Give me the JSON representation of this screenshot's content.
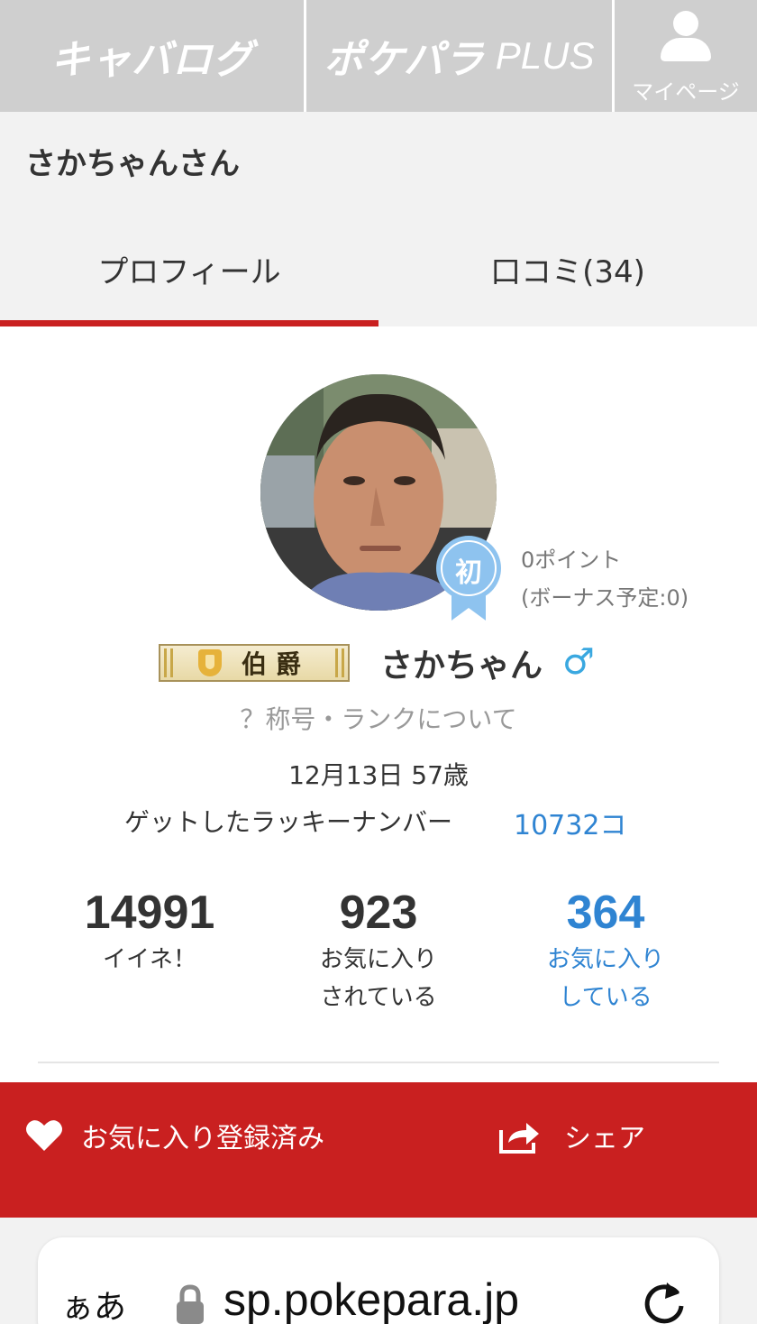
{
  "topnav": {
    "logo1": "キャバログ",
    "logo2": "ポケパラ",
    "logo2_suffix": "PLUS",
    "mypage_label": "マイページ"
  },
  "header": {
    "title": "さかちゃんさん"
  },
  "tabs": [
    {
      "label": "プロフィール",
      "active": true
    },
    {
      "label": "口コミ(34)",
      "active": false
    }
  ],
  "profile": {
    "badge_label": "初",
    "points": "0ポイント",
    "bonus": "(ボーナス予定:0)",
    "rank_title": "伯爵",
    "nickname": "さかちゃん",
    "gender_symbol": "♂",
    "about_rank_link": "？称号・ランクについて",
    "birthday_age": "12月13日 57歳",
    "lucky_label": "ゲットしたラッキーナンバー",
    "lucky_count": "10732コ"
  },
  "stats": [
    {
      "value": "14991",
      "label_line1": "イイネ！",
      "label_line2": ""
    },
    {
      "value": "923",
      "label_line1": "お気に入り",
      "label_line2": "されている"
    },
    {
      "value": "364",
      "label_line1": "お気に入り",
      "label_line2": "している"
    }
  ],
  "actions": {
    "favorite_label": "お気に入り登録済み",
    "share_label": "シェア"
  },
  "browser": {
    "aa_label": "ぁあ",
    "url": "sp.pokepara.jp"
  },
  "colors": {
    "accent_red": "#c92020",
    "link_blue": "#2f84d2",
    "nav_gray": "#cfcfcf",
    "gender_blue": "#3aa8e0",
    "badge_blue": "#8ec3ef"
  }
}
